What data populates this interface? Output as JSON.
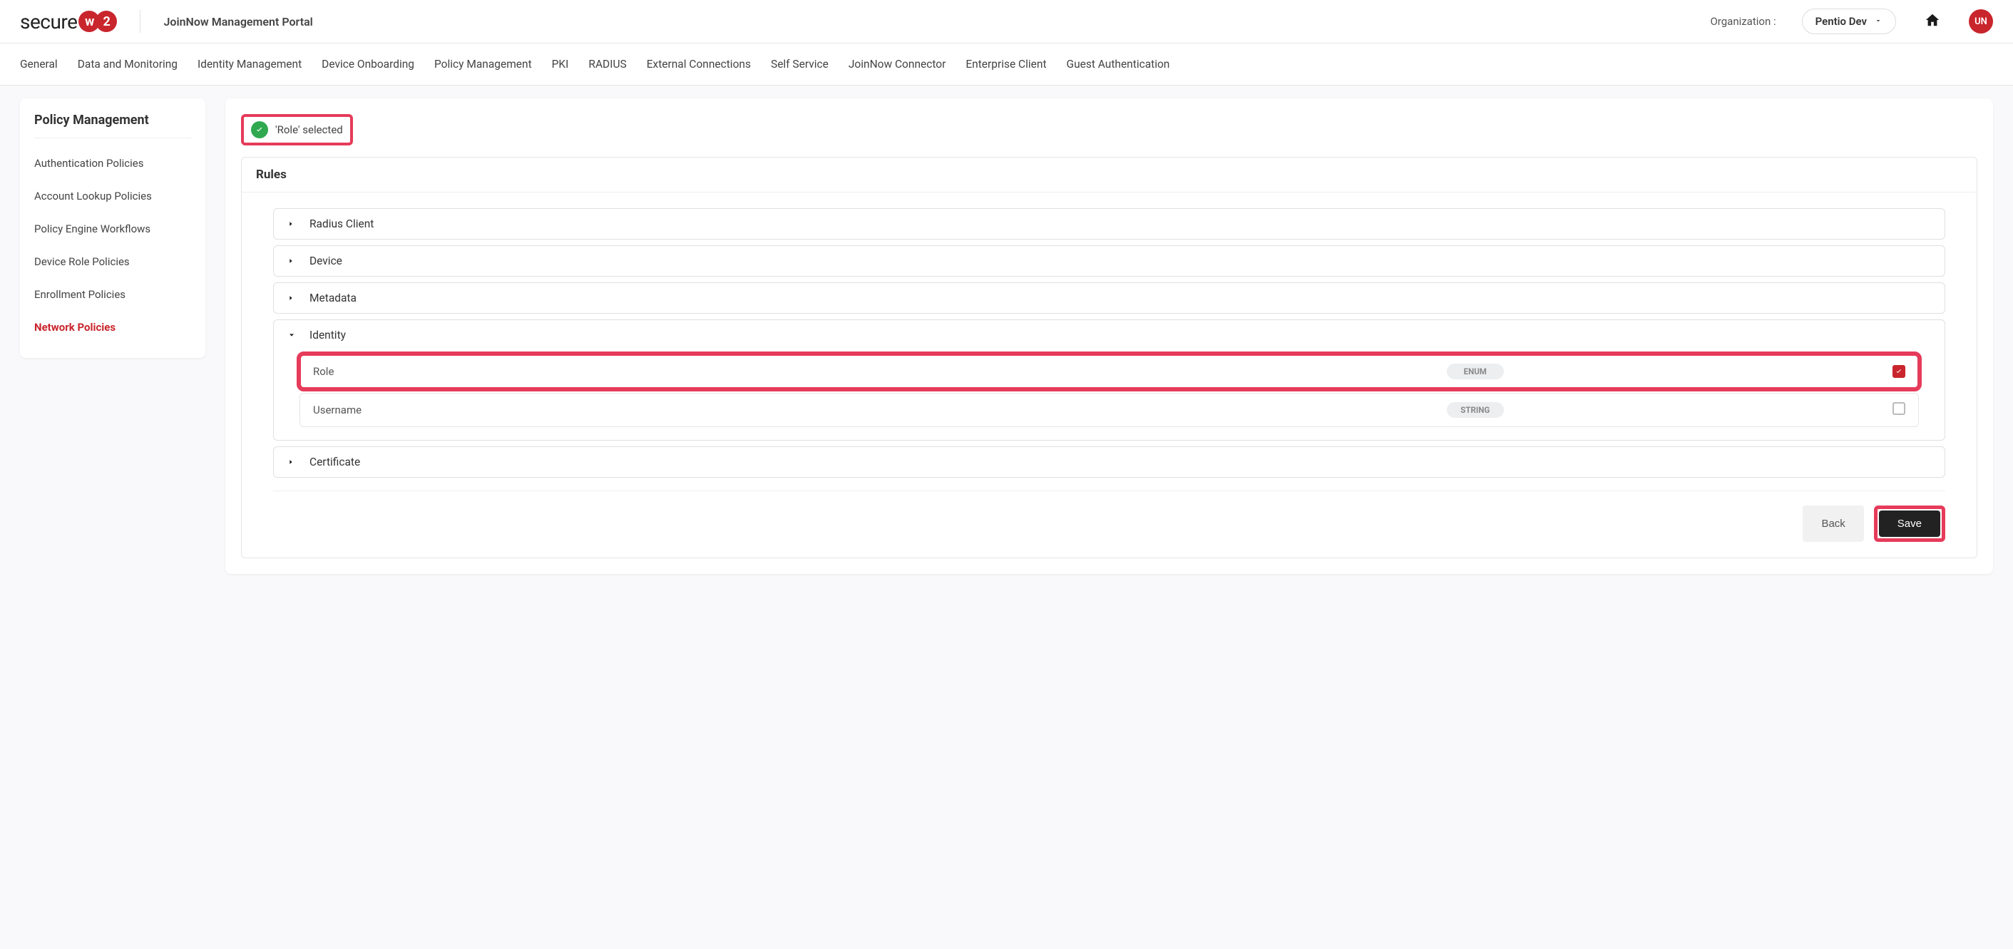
{
  "header": {
    "org_label": "Organization :",
    "org_value": "Pentio Dev",
    "portal_title": "JoinNow Management Portal",
    "avatar_initials": "UN",
    "logo_text": "secure",
    "logo_circle_1": "w",
    "logo_circle_2": "2"
  },
  "topnav": [
    "General",
    "Data and Monitoring",
    "Identity Management",
    "Device Onboarding",
    "Policy Management",
    "PKI",
    "RADIUS",
    "External Connections",
    "Self Service",
    "JoinNow Connector",
    "Enterprise Client",
    "Guest Authentication"
  ],
  "sidebar": {
    "title": "Policy Management",
    "items": [
      {
        "label": "Authentication Policies",
        "active": false
      },
      {
        "label": "Account Lookup Policies",
        "active": false
      },
      {
        "label": "Policy Engine Workflows",
        "active": false
      },
      {
        "label": "Device Role Policies",
        "active": false
      },
      {
        "label": "Enrollment Policies",
        "active": false
      },
      {
        "label": "Network Policies",
        "active": true
      }
    ]
  },
  "alert": {
    "text": "'Role' selected"
  },
  "rules": {
    "header": "Rules",
    "groups": [
      {
        "label": "Radius Client",
        "open": false
      },
      {
        "label": "Device",
        "open": false
      },
      {
        "label": "Metadata",
        "open": false
      },
      {
        "label": "Identity",
        "open": true,
        "attrs": [
          {
            "name": "Role",
            "type": "ENUM",
            "checked": true,
            "highlighted": true
          },
          {
            "name": "Username",
            "type": "STRING",
            "checked": false,
            "highlighted": false
          }
        ]
      },
      {
        "label": "Certificate",
        "open": false
      }
    ]
  },
  "buttons": {
    "back": "Back",
    "save": "Save"
  }
}
